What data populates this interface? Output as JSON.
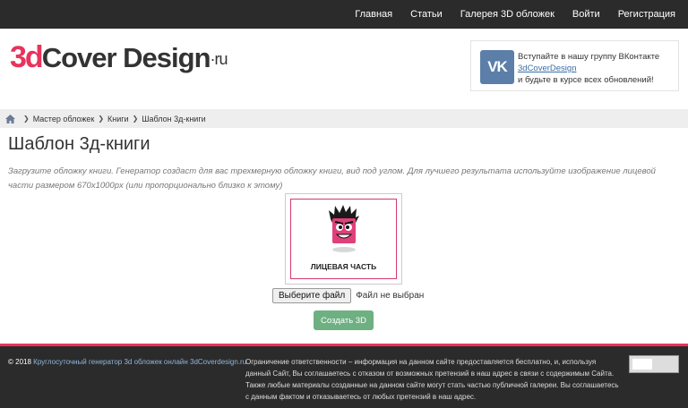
{
  "nav": {
    "items": [
      "Главная",
      "Статьи",
      "Галерея 3D обложек",
      "Войти",
      "Регистрация"
    ]
  },
  "logo": {
    "part_3d": "3d",
    "part_name": "Cover Design",
    "part_tld": "·ru"
  },
  "vk": {
    "badge": "VK",
    "line1": "Вступайте в нашу группу ВКонтакте",
    "link": "3dCoverDesign",
    "line3": "и будьте в курсе всех обновлений!"
  },
  "breadcrumb": {
    "items": [
      "Мастер обложек",
      "Книги",
      "Шаблон 3д-книги"
    ]
  },
  "page": {
    "title": "Шаблон 3д-книги",
    "description": "Загрузите обложку книги. Генератор создаст для вас трехмерную обложку книги, вид под углом. Для лучшего результата используйте изображение лицевой части размером 670x1000px (или пропорционально близко к этому)"
  },
  "cover_preview": {
    "label": "ЛИЦЕВАЯ ЧАСТЬ"
  },
  "upload": {
    "choose_label": "Выберите файл",
    "status": "Файл не выбран"
  },
  "create_button": {
    "label": "Создать 3D"
  },
  "footer": {
    "copyright": "© 2018",
    "copyright_link": "Круглосуточный генератор 3d обложек онлайн 3dCoverdesign.ru",
    "disclaimer": "Ограничение ответственности – информация на данном сайте предоставляется бесплатно, и, используя данный Сайт, Вы соглашаетесь с отказом от возможных претензий в наш адрес в связи с содержимым Сайта. Также любые материалы созданные на данном сайте могут стать частью публичной галереи. Вы соглашаетесь с данным фактом и отказываетесь от любых претензий в наш адрес."
  },
  "colors": {
    "accent": "#e8335b",
    "nav_bg": "#2b2b2b",
    "button_green": "#6eb081",
    "vk_blue": "#5b7fa8"
  }
}
